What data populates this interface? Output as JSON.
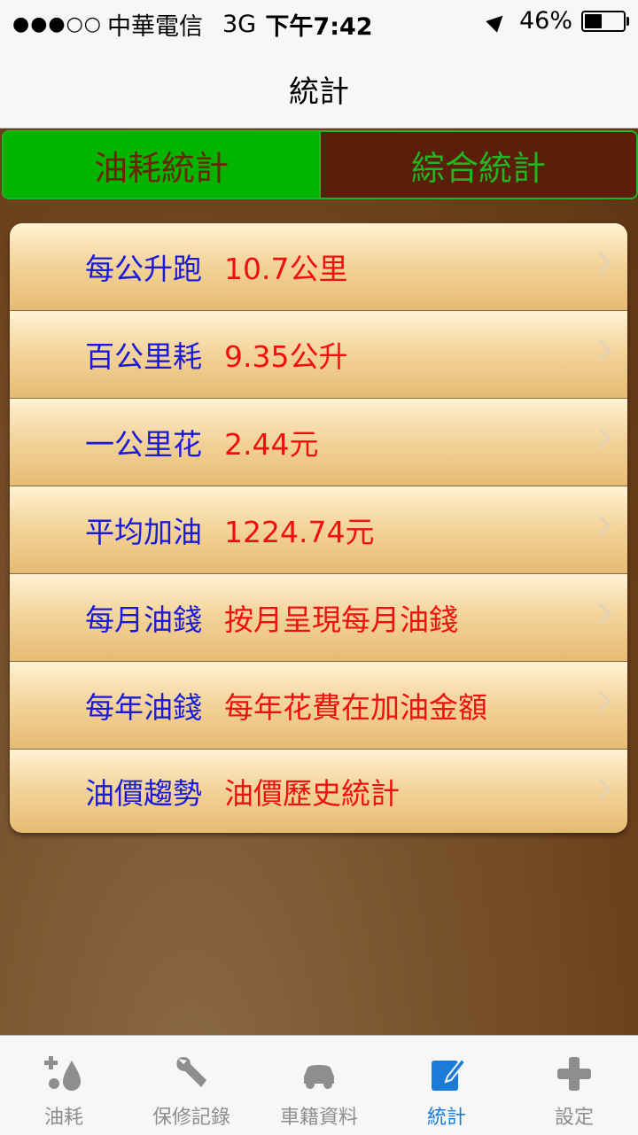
{
  "status": {
    "signal": "●●●○○",
    "carrier": "中華電信",
    "network": "3G",
    "time": "下午7:42",
    "battery": "46%"
  },
  "nav": {
    "title": "統計"
  },
  "segments": [
    {
      "label": "油耗統計",
      "selected": true
    },
    {
      "label": "綜合統計",
      "selected": false
    }
  ],
  "rows": [
    {
      "label": "每公升跑",
      "value": "10.7公里"
    },
    {
      "label": "百公里耗",
      "value": "9.35公升"
    },
    {
      "label": "一公里花",
      "value": "2.44元"
    },
    {
      "label": "平均加油",
      "value": "1224.74元"
    },
    {
      "label": "每月油錢",
      "value": "按月呈現每月油錢"
    },
    {
      "label": "每年油錢",
      "value": "每年花費在加油金額"
    },
    {
      "label": "油價趨勢",
      "value": "油價歷史統計"
    }
  ],
  "tabs": [
    {
      "label": "油耗",
      "icon": "fuel-drop-icon",
      "active": false
    },
    {
      "label": "保修記錄",
      "icon": "wrench-icon",
      "active": false
    },
    {
      "label": "車籍資料",
      "icon": "car-icon",
      "active": false
    },
    {
      "label": "統計",
      "icon": "notepad-icon",
      "active": true
    },
    {
      "label": "設定",
      "icon": "plus-icon",
      "active": false
    }
  ],
  "colors": {
    "segment_active_bg": "#00b400",
    "segment_inactive_bg": "#5a1e0a",
    "row_label": "#1a1ad8",
    "row_value": "#f01010",
    "tab_active": "#1a7bd8",
    "tab_inactive": "#8e8e8e"
  }
}
